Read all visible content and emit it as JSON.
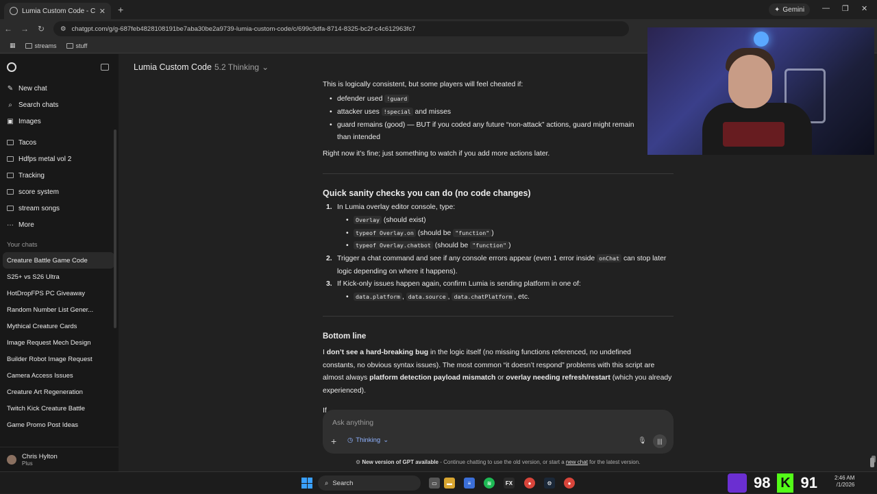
{
  "browser": {
    "tab_title": "Lumia Custom Code - Creature",
    "gemini_label": "Gemini",
    "url": "chatgpt.com/g/g-687feb4828108191be7aba30be2a9739-lumia-custom-code/c/699c9dfa-8714-8325-bc2f-c4c612963fc7",
    "bookmarks": [
      "streams",
      "stuff"
    ]
  },
  "sidebar": {
    "actions": [
      {
        "label": "New chat",
        "icon": "✎"
      },
      {
        "label": "Search chats",
        "icon": "⌕"
      },
      {
        "label": "Images",
        "icon": "▣"
      }
    ],
    "projects": [
      "Tacos",
      "Hdfps metal vol 2",
      "Tracking",
      "score system",
      "stream songs"
    ],
    "more_label": "More",
    "section_title": "Your chats",
    "chats": [
      "Creature Battle Game Code",
      "S25+ vs S26 Ultra",
      "HotDropFPS PC Giveaway",
      "Random Number List Gener...",
      "Mythical Creature Cards",
      "Image Request Mech Design",
      "Builder Robot Image Request",
      "Camera Access Issues",
      "Creature Art Regeneration",
      "Twitch Kick Creature Battle",
      "Game Promo Post Ideas"
    ],
    "user": {
      "name": "Chris Hylton",
      "plan": "Plus"
    }
  },
  "header": {
    "model_name": "Lumia Custom Code",
    "model_version": "5.2 Thinking"
  },
  "message": {
    "intro": "This is logically consistent, but some players will feel cheated if:",
    "cheat_items": [
      {
        "pre": "defender used ",
        "code": "!guard"
      },
      {
        "pre": "attacker uses ",
        "code": "!special",
        "post": " and misses"
      }
    ],
    "cheat_item3_line1": "guard remains (good) — BUT if you coded any future “non-attack” actions, guard might remain",
    "cheat_item3_line2": "than intended",
    "watch_note": "Right now it’s fine; just something to watch if you add more actions later.",
    "checks_heading": "Quick sanity checks you can do (no code changes)",
    "check1": "In Lumia overlay editor console, type:",
    "check1_items": [
      {
        "code": "Overlay",
        "note": " (should exist)"
      },
      {
        "code": "typeof Overlay.on",
        "note": " (should be ",
        "code2": "\"function\"",
        "end": ")"
      },
      {
        "code": "typeof Overlay.chatbot",
        "note": " (should be ",
        "code2": "\"function\"",
        "end": ")"
      }
    ],
    "check2_a": "Trigger a chat command and see if any console errors appear (even 1 error inside ",
    "check2_code": "onChat",
    "check2_b": " can stop later",
    "check2_line2": "logic depending on where it happens).",
    "check3": "If Kick-only issues happen again, confirm Lumia is sending platform in one of:",
    "check3_codes": [
      "data.platform",
      "data.source",
      "data.chatPlatform"
    ],
    "check3_sep": ", ",
    "check3_end": ", etc.",
    "bottom_heading": "Bottom line",
    "bottom_l1_a": "I ",
    "bottom_l1_b": "don’t see a hard-breaking bug",
    "bottom_l1_c": " in the logic itself (no missing functions referenced, no undefined",
    "bottom_l2": "constants, no obvious syntax issues). The most common “it doesn’t respond” problems with this script are",
    "bottom_l3_a": "almost always ",
    "bottom_l3_b": "platform detection payload mismatch",
    "bottom_l3_c": " or ",
    "bottom_l3_d": "overlay needing refresh/restart",
    "bottom_l3_e": " (which you already",
    "bottom_l4": "experienced).",
    "trailing": "If"
  },
  "composer": {
    "placeholder": "Ask anything",
    "mode": "Thinking"
  },
  "notice": {
    "bold": "New version of GPT available",
    "text": " - Continue chatting to use the old version, or start a ",
    "link": "new chat",
    "end": " for the latest version."
  },
  "taskbar": {
    "search_label": "Search",
    "score_twitch": "98",
    "score_kick": "91",
    "time": "2:46 AM",
    "date": "/1/2026"
  },
  "colors": {
    "accent_blue": "#8fb2ff",
    "twitch": "#6b2fd1",
    "kick": "#53fc18"
  }
}
